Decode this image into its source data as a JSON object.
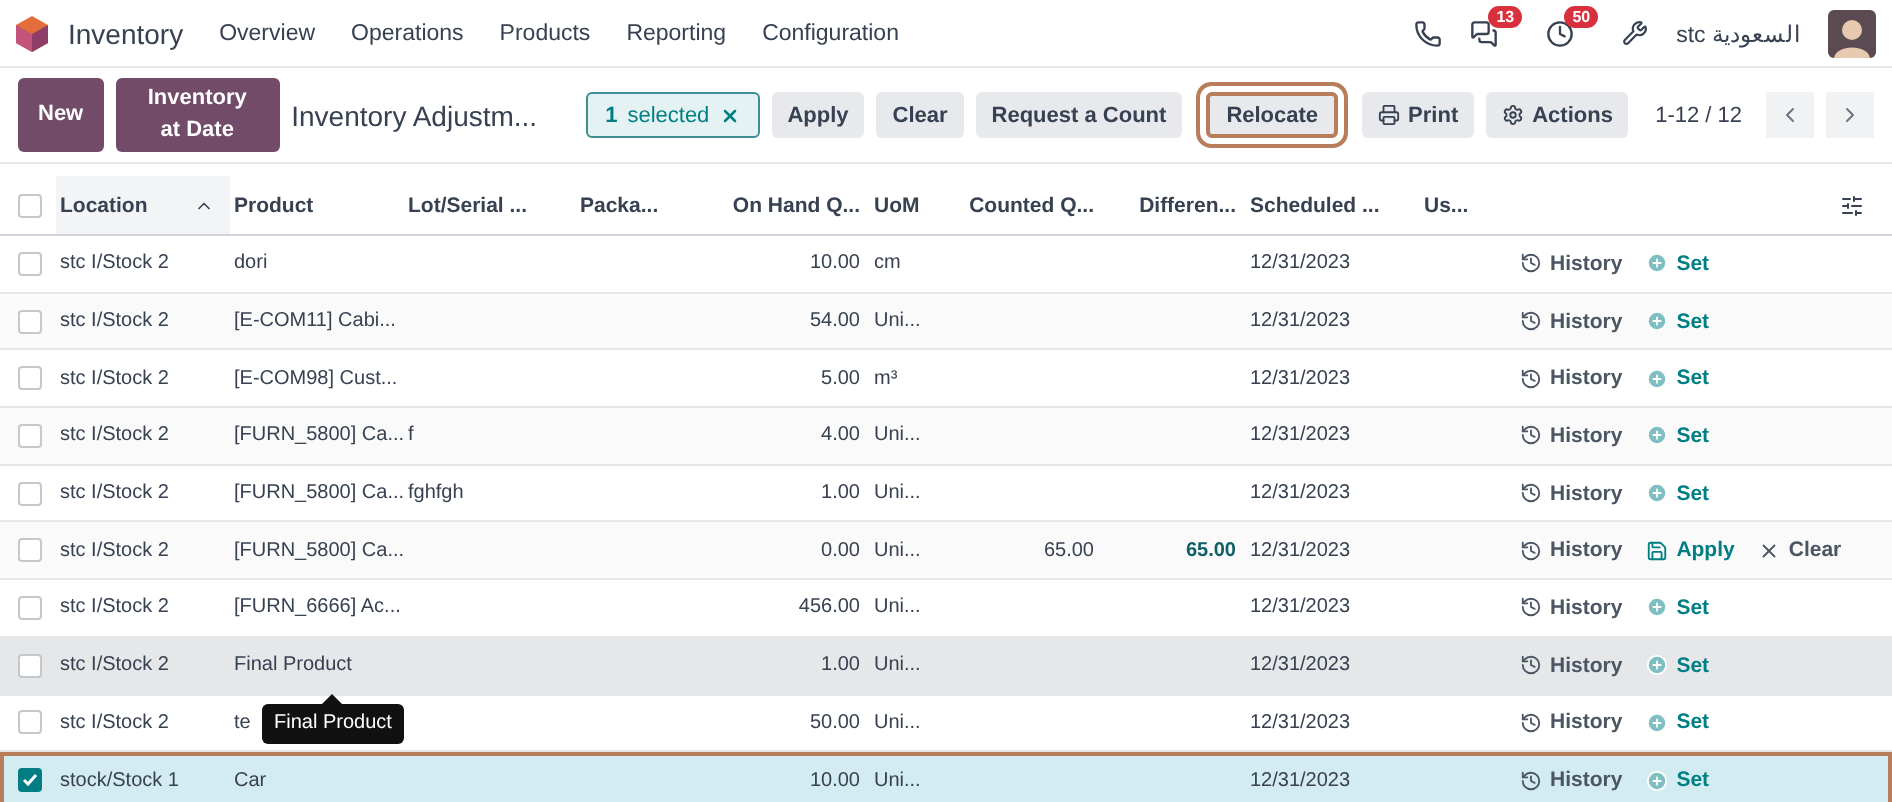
{
  "app": {
    "name": "Inventory"
  },
  "menu": [
    "Overview",
    "Operations",
    "Products",
    "Reporting",
    "Configuration"
  ],
  "systray": {
    "messages_count": "13",
    "activities_count": "50",
    "company": "السعودية stc"
  },
  "control_panel": {
    "primary_buttons": [
      "New",
      "Inventory at Date"
    ],
    "title": "Inventory Adjustm...",
    "selection": {
      "count": "1",
      "label": "selected"
    },
    "actions": [
      {
        "label": "Apply",
        "kind": "plain",
        "highlighted": false
      },
      {
        "label": "Clear",
        "kind": "plain",
        "highlighted": false
      },
      {
        "label": "Request a Count",
        "kind": "plain",
        "highlighted": false
      },
      {
        "label": "Relocate",
        "kind": "plain",
        "highlighted": true
      },
      {
        "label": "Print",
        "kind": "print",
        "highlighted": false
      },
      {
        "label": "Actions",
        "kind": "gear",
        "highlighted": false
      }
    ],
    "pager": "1-12 / 12"
  },
  "table": {
    "all_selected": false,
    "columns": [
      {
        "label": "Location",
        "sorted": true
      },
      {
        "label": "Product",
        "sorted": false
      },
      {
        "label": "Lot/Serial ...",
        "sorted": false
      },
      {
        "label": "Packa...",
        "sorted": false
      },
      {
        "label": "On Hand Q...",
        "sorted": false
      },
      {
        "label": "UoM",
        "sorted": false
      },
      {
        "label": "Counted Q...",
        "sorted": false
      },
      {
        "label": "Differen...",
        "sorted": false
      },
      {
        "label": "Scheduled ...",
        "sorted": false
      },
      {
        "label": "Us...",
        "sorted": false
      }
    ],
    "rows": [
      {
        "location": "stc I/Stock 2",
        "product": "dori",
        "on_hand": "10.00",
        "uom": "cm",
        "scheduled": "12/31/2023",
        "selected": false,
        "hovered": false,
        "highlighted": false,
        "actions": [
          {
            "kind": "history",
            "label": "History"
          },
          {
            "kind": "set",
            "label": "Set"
          }
        ]
      },
      {
        "location": "stc I/Stock 2",
        "product": "[E-COM11] Cabi...",
        "on_hand": "54.00",
        "uom": "Uni...",
        "scheduled": "12/31/2023",
        "selected": false,
        "hovered": false,
        "highlighted": false,
        "actions": [
          {
            "kind": "history",
            "label": "History"
          },
          {
            "kind": "set",
            "label": "Set"
          }
        ]
      },
      {
        "location": "stc I/Stock 2",
        "product": "[E-COM98] Cust...",
        "on_hand": "5.00",
        "uom": "m³",
        "scheduled": "12/31/2023",
        "selected": false,
        "hovered": false,
        "highlighted": false,
        "actions": [
          {
            "kind": "history",
            "label": "History"
          },
          {
            "kind": "set",
            "label": "Set"
          }
        ]
      },
      {
        "location": "stc I/Stock 2",
        "product": "[FURN_5800] Ca...",
        "lot": "f",
        "on_hand": "4.00",
        "uom": "Uni...",
        "scheduled": "12/31/2023",
        "selected": false,
        "hovered": false,
        "highlighted": false,
        "actions": [
          {
            "kind": "history",
            "label": "History"
          },
          {
            "kind": "set",
            "label": "Set"
          }
        ]
      },
      {
        "location": "stc I/Stock 2",
        "product": "[FURN_5800] Ca...",
        "lot": "fghfgh",
        "on_hand": "1.00",
        "uom": "Uni...",
        "scheduled": "12/31/2023",
        "selected": false,
        "hovered": false,
        "highlighted": false,
        "actions": [
          {
            "kind": "history",
            "label": "History"
          },
          {
            "kind": "set",
            "label": "Set"
          }
        ]
      },
      {
        "location": "stc I/Stock 2",
        "product": "[FURN_5800] Ca...",
        "on_hand": "0.00",
        "uom": "Uni...",
        "counted": "65.00",
        "difference": "65.00",
        "scheduled": "12/31/2023",
        "selected": false,
        "hovered": false,
        "highlighted": false,
        "actions": [
          {
            "kind": "history",
            "label": "History"
          },
          {
            "kind": "apply",
            "label": "Apply"
          },
          {
            "kind": "clear",
            "label": "Clear"
          }
        ]
      },
      {
        "location": "stc I/Stock 2",
        "product": "[FURN_6666] Ac...",
        "on_hand": "456.00",
        "uom": "Uni...",
        "scheduled": "12/31/2023",
        "selected": false,
        "hovered": false,
        "highlighted": false,
        "actions": [
          {
            "kind": "history",
            "label": "History"
          },
          {
            "kind": "set",
            "label": "Set"
          }
        ]
      },
      {
        "location": "stc I/Stock 2",
        "product": "Final Product",
        "on_hand": "1.00",
        "uom": "Uni...",
        "scheduled": "12/31/2023",
        "selected": false,
        "hovered": true,
        "highlighted": false,
        "tooltip": "Final Product",
        "actions": [
          {
            "kind": "history",
            "label": "History"
          },
          {
            "kind": "set",
            "label": "Set"
          }
        ]
      },
      {
        "location": "stc I/Stock 2",
        "product": "te",
        "on_hand": "50.00",
        "uom": "Uni...",
        "scheduled": "12/31/2023",
        "selected": false,
        "hovered": false,
        "highlighted": false,
        "actions": [
          {
            "kind": "history",
            "label": "History"
          },
          {
            "kind": "set",
            "label": "Set"
          }
        ]
      },
      {
        "location": "stock/Stock 1",
        "product": "Car",
        "on_hand": "10.00",
        "uom": "Uni...",
        "scheduled": "12/31/2023",
        "selected": true,
        "hovered": false,
        "highlighted": true,
        "actions": [
          {
            "kind": "history",
            "label": "History"
          },
          {
            "kind": "set",
            "label": "Set"
          }
        ]
      }
    ]
  }
}
